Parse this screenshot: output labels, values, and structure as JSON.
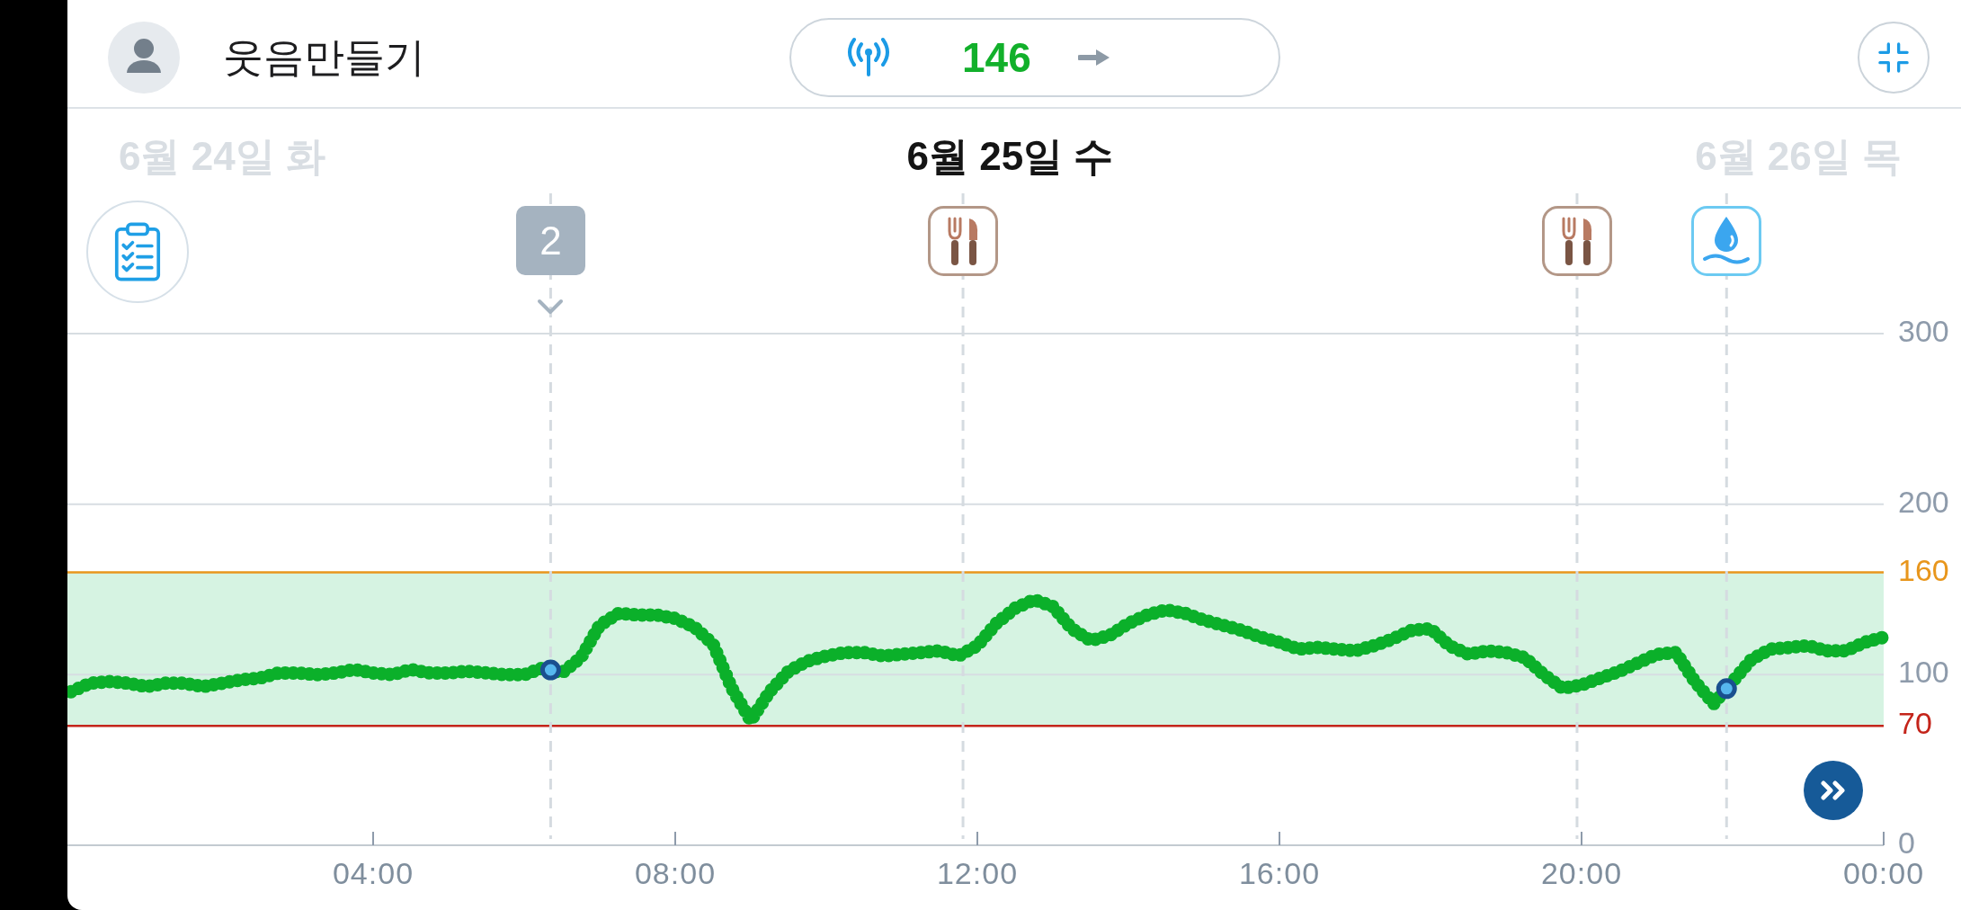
{
  "profile": {
    "name": "웃음만들기"
  },
  "live_reading": {
    "value": "146"
  },
  "date_tabs": [
    {
      "label": "6월 24일 화",
      "selected": false
    },
    {
      "label": "6월 25일 수",
      "selected": true
    },
    {
      "label": "6월 26일 목",
      "selected": false
    }
  ],
  "events": [
    {
      "kind": "count",
      "label": "2",
      "curve_marker": true
    },
    {
      "kind": "meal",
      "curve_marker": false
    },
    {
      "kind": "meal",
      "curve_marker": false
    },
    {
      "kind": "drop",
      "curve_marker": true
    }
  ],
  "chart": {
    "chart_data": {
      "type": "line",
      "x": [
        0,
        0.25,
        0.5,
        0.75,
        1,
        1.25,
        1.5,
        1.75,
        2,
        2.25,
        2.5,
        2.75,
        3,
        3.25,
        3.5,
        3.75,
        4,
        4.25,
        4.5,
        4.75,
        5,
        5.25,
        5.5,
        5.75,
        6,
        6.25,
        6.5,
        6.75,
        7,
        7.25,
        7.5,
        7.75,
        8,
        8.25,
        8.5,
        8.75,
        9,
        9.25,
        9.5,
        9.75,
        10,
        10.25,
        10.5,
        10.75,
        11,
        11.25,
        11.5,
        11.75,
        12,
        12.25,
        12.5,
        12.75,
        13,
        13.25,
        13.5,
        13.75,
        14,
        14.25,
        14.5,
        14.75,
        15,
        15.25,
        15.5,
        15.75,
        16,
        16.25,
        16.5,
        16.75,
        17,
        17.25,
        17.5,
        17.75,
        18,
        18.25,
        18.5,
        18.75,
        19,
        19.25,
        19.5,
        19.75,
        20,
        20.25,
        20.5,
        20.75,
        21,
        21.25,
        21.5,
        21.75,
        22,
        22.25,
        22.5,
        22.75,
        23,
        23.25,
        23.5,
        23.75,
        24
      ],
      "series": [
        {
          "color": "#0bb02a",
          "line_style": "dotted",
          "values": [
            90,
            95,
            96,
            95,
            93,
            95,
            95,
            93,
            95,
            97,
            98,
            101,
            101,
            100,
            101,
            103,
            101,
            100,
            103,
            101,
            101,
            102,
            101,
            100,
            100,
            104,
            101,
            110,
            129,
            136,
            135,
            135,
            133,
            128,
            118,
            92,
            73,
            90,
            102,
            108,
            111,
            113,
            113,
            111,
            112,
            113,
            114,
            111,
            117,
            130,
            139,
            144,
            140,
            127,
            120,
            123,
            130,
            135,
            138,
            136,
            132,
            129,
            126,
            122,
            119,
            115,
            116,
            115,
            114,
            117,
            121,
            126,
            127,
            117,
            112,
            114,
            113,
            110,
            100,
            92,
            94,
            98,
            102,
            107,
            112,
            113,
            96,
            83,
            96,
            109,
            115,
            116,
            117,
            114,
            114,
            119,
            122
          ]
        }
      ],
      "xlim": [
        0,
        24
      ],
      "ylim": [
        0,
        300
      ],
      "xticks": [
        {
          "value": 4,
          "label": "04:00"
        },
        {
          "value": 8,
          "label": "08:00"
        },
        {
          "value": 12,
          "label": "12:00"
        },
        {
          "value": 16,
          "label": "16:00"
        },
        {
          "value": 20,
          "label": "20:00"
        },
        {
          "value": 24,
          "label": "00:00"
        }
      ],
      "yticks": [
        0,
        70,
        100,
        160,
        200,
        300
      ],
      "bands": [
        {
          "axis": "y",
          "from": 70,
          "to": 160,
          "color": "#d6f3e2"
        }
      ],
      "ref_lines": [
        {
          "axis": "y",
          "value": 160,
          "color": "#e8961c",
          "line_style": "solid"
        },
        {
          "axis": "y",
          "value": 70,
          "color": "#c4241a",
          "line_style": "solid"
        },
        {
          "axis": "x",
          "value": 6.35,
          "color": "#d5dbe0",
          "line_style": "dashed"
        },
        {
          "axis": "x",
          "value": 11.81,
          "color": "#d5dbe0",
          "line_style": "dashed"
        },
        {
          "axis": "x",
          "value": 19.94,
          "color": "#d5dbe0",
          "line_style": "dashed"
        },
        {
          "axis": "x",
          "value": 21.92,
          "color": "#d5dbe0",
          "line_style": "dashed"
        }
      ]
    }
  }
}
